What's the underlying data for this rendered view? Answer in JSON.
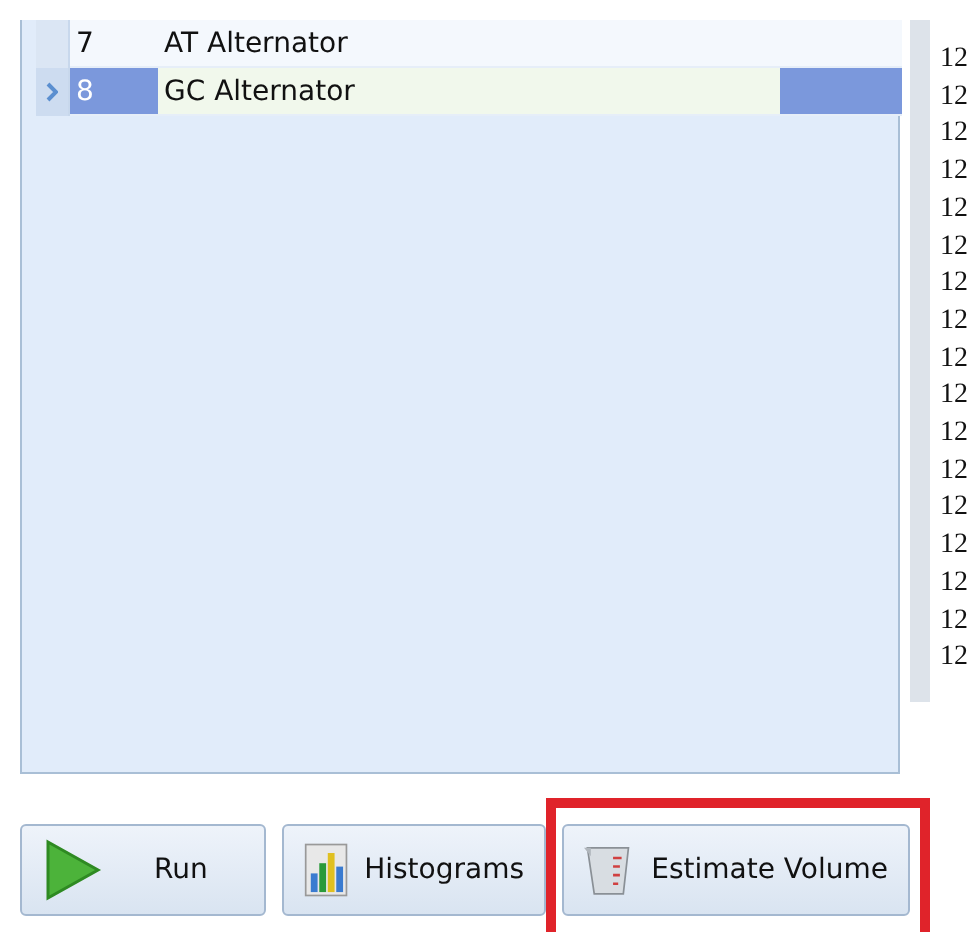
{
  "grid": {
    "rows": [
      {
        "number": "7",
        "name": "AT Alternator",
        "selected": false
      },
      {
        "number": "8",
        "name": "GC Alternator",
        "selected": true
      }
    ]
  },
  "log_lines": [
    "12",
    "12",
    "12",
    "12",
    "12",
    "12",
    "12",
    "12",
    "12",
    "12",
    "12",
    "12",
    "12",
    "12",
    "12",
    "12",
    "12"
  ],
  "buttons": [
    {
      "kind": "run",
      "label": "Run",
      "highlighted": false
    },
    {
      "kind": "histogram",
      "label": "Histograms",
      "highlighted": false
    },
    {
      "kind": "volume",
      "label": "Estimate Volume",
      "highlighted": true
    }
  ]
}
